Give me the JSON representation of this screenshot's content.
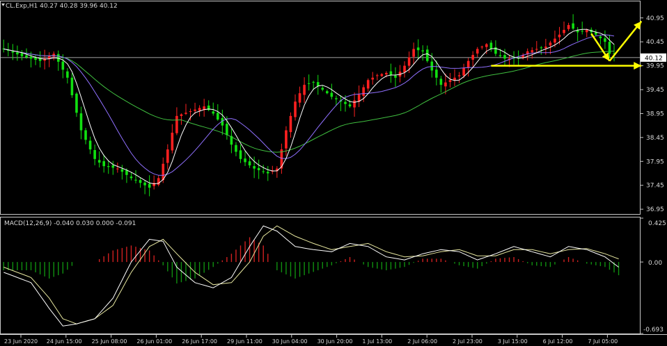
{
  "window": {
    "symbol_line": "CL.Exp,H1 40.27 40.28 39.96 40.12"
  },
  "chart_data": [
    {
      "type": "candlestick",
      "symbol": "CL.Exp",
      "timeframe": "H1",
      "ohlc_header": {
        "open": 40.27,
        "high": 40.28,
        "low": 39.96,
        "close": 40.12
      },
      "current_price": 40.12,
      "ylim": [
        36.85,
        41.15
      ],
      "y_ticks": [
        {
          "value": 40.95,
          "label": "40.95"
        },
        {
          "value": 40.45,
          "label": "40.45"
        },
        {
          "value": 39.95,
          "label": "39.95"
        },
        {
          "value": 39.45,
          "label": "39.45"
        },
        {
          "value": 38.95,
          "label": "38.95"
        },
        {
          "value": 38.45,
          "label": "38.45"
        },
        {
          "value": 37.95,
          "label": "37.95"
        },
        {
          "value": 37.45,
          "label": "37.45"
        },
        {
          "value": 36.95,
          "label": "36.95"
        }
      ],
      "x_ticks": [
        "23 Jun 2020",
        "24 Jun 15:00",
        "25 Jun 08:00",
        "26 Jun 01:00",
        "26 Jun 17:00",
        "29 Jun 11:00",
        "30 Jun 04:00",
        "30 Jun 20:00",
        "1 Jul 13:00",
        "2 Jul 06:00",
        "2 Jul 23:00",
        "3 Jul 15:00",
        "6 Jul 12:00",
        "7 Jul 05:00"
      ],
      "colors": {
        "up": "#ff2020",
        "down": "#10e010",
        "ma_fast": "#ffffff",
        "ma_mid": "#9070ff",
        "ma_slow": "#40c040",
        "annotation": "#ffff00"
      },
      "close_path": [
        [
          0,
          40.3
        ],
        [
          4,
          40.15
        ],
        [
          8,
          40.05
        ],
        [
          11,
          40.2
        ],
        [
          14,
          39.7
        ],
        [
          17,
          38.6
        ],
        [
          20,
          38.0
        ],
        [
          22,
          37.85
        ],
        [
          25,
          37.8
        ],
        [
          28,
          37.6
        ],
        [
          30,
          37.5
        ],
        [
          32,
          37.4
        ],
        [
          34,
          37.6
        ],
        [
          36,
          38.2
        ],
        [
          38,
          38.9
        ],
        [
          41,
          39.0
        ],
        [
          44,
          39.1
        ],
        [
          46,
          38.95
        ],
        [
          48,
          38.7
        ],
        [
          50,
          38.3
        ],
        [
          52,
          38.0
        ],
        [
          55,
          37.8
        ],
        [
          58,
          37.7
        ],
        [
          60,
          37.8
        ],
        [
          62,
          38.6
        ],
        [
          64,
          39.2
        ],
        [
          66,
          39.55
        ],
        [
          68,
          39.6
        ],
        [
          70,
          39.45
        ],
        [
          72,
          39.3
        ],
        [
          74,
          39.2
        ],
        [
          76,
          39.1
        ],
        [
          78,
          39.35
        ],
        [
          80,
          39.65
        ],
        [
          82,
          39.75
        ],
        [
          84,
          39.8
        ],
        [
          86,
          39.7
        ],
        [
          88,
          39.95
        ],
        [
          90,
          40.3
        ],
        [
          92,
          40.25
        ],
        [
          94,
          39.85
        ],
        [
          96,
          39.55
        ],
        [
          98,
          39.65
        ],
        [
          100,
          39.75
        ],
        [
          102,
          40.05
        ],
        [
          104,
          40.3
        ],
        [
          106,
          40.4
        ],
        [
          108,
          40.2
        ],
        [
          110,
          40.1
        ],
        [
          113,
          40.1
        ],
        [
          115,
          40.25
        ],
        [
          117,
          40.3
        ],
        [
          119,
          40.35
        ],
        [
          122,
          40.6
        ],
        [
          124,
          40.8
        ],
        [
          126,
          40.65
        ],
        [
          128,
          40.7
        ],
        [
          130,
          40.6
        ],
        [
          132,
          40.45
        ],
        [
          133,
          40.2
        ]
      ],
      "annotations": [
        {
          "type": "arrow",
          "from": [
            129,
            40.62
          ],
          "to": [
            133,
            40.05
          ],
          "label": ""
        },
        {
          "type": "arrow",
          "from": [
            133,
            40.05
          ],
          "to": [
            140,
            40.88
          ],
          "label": ""
        },
        {
          "type": "horizontal_arrow",
          "y": 39.95,
          "from_x": 107,
          "to_x": 140,
          "label": ""
        }
      ]
    },
    {
      "type": "macd",
      "title": "MACD(12,26,9) -0.040 0.030 0.000 -0.091",
      "params": [
        12,
        26,
        9
      ],
      "values_header": [
        -0.04,
        0.03,
        0.0,
        -0.091
      ],
      "ylim": [
        -0.693,
        0.425
      ],
      "y_ticks": [
        {
          "value": 0.425,
          "label": "0.425"
        },
        {
          "value": 0.0,
          "label": "0.00"
        },
        {
          "value": -0.693,
          "label": "-0.693"
        }
      ],
      "macd_line": [
        [
          0,
          -0.1
        ],
        [
          6,
          -0.2
        ],
        [
          10,
          -0.45
        ],
        [
          13,
          -0.62
        ],
        [
          16,
          -0.6
        ],
        [
          20,
          -0.55
        ],
        [
          24,
          -0.35
        ],
        [
          28,
          0.0
        ],
        [
          32,
          0.22
        ],
        [
          35,
          0.2
        ],
        [
          38,
          -0.05
        ],
        [
          42,
          -0.2
        ],
        [
          46,
          -0.25
        ],
        [
          50,
          -0.15
        ],
        [
          54,
          0.15
        ],
        [
          57,
          0.35
        ],
        [
          60,
          0.3
        ],
        [
          64,
          0.15
        ],
        [
          68,
          0.12
        ],
        [
          72,
          0.1
        ],
        [
          76,
          0.18
        ],
        [
          80,
          0.15
        ],
        [
          84,
          0.05
        ],
        [
          88,
          0.02
        ],
        [
          92,
          0.08
        ],
        [
          96,
          0.12
        ],
        [
          100,
          0.1
        ],
        [
          104,
          0.02
        ],
        [
          108,
          0.08
        ],
        [
          112,
          0.15
        ],
        [
          116,
          0.1
        ],
        [
          120,
          0.05
        ],
        [
          124,
          0.15
        ],
        [
          128,
          0.12
        ],
        [
          132,
          0.05
        ],
        [
          135,
          -0.05
        ]
      ],
      "signal_line": [
        [
          0,
          -0.05
        ],
        [
          6,
          -0.15
        ],
        [
          10,
          -0.35
        ],
        [
          13,
          -0.55
        ],
        [
          16,
          -0.6
        ],
        [
          20,
          -0.55
        ],
        [
          24,
          -0.42
        ],
        [
          28,
          -0.1
        ],
        [
          32,
          0.15
        ],
        [
          35,
          0.22
        ],
        [
          38,
          0.08
        ],
        [
          42,
          -0.1
        ],
        [
          46,
          -0.22
        ],
        [
          50,
          -0.2
        ],
        [
          54,
          0.0
        ],
        [
          57,
          0.25
        ],
        [
          60,
          0.35
        ],
        [
          64,
          0.25
        ],
        [
          68,
          0.18
        ],
        [
          72,
          0.12
        ],
        [
          76,
          0.15
        ],
        [
          80,
          0.18
        ],
        [
          84,
          0.1
        ],
        [
          88,
          0.05
        ],
        [
          92,
          0.06
        ],
        [
          96,
          0.1
        ],
        [
          100,
          0.12
        ],
        [
          104,
          0.06
        ],
        [
          108,
          0.06
        ],
        [
          112,
          0.12
        ],
        [
          116,
          0.12
        ],
        [
          120,
          0.08
        ],
        [
          124,
          0.12
        ],
        [
          128,
          0.13
        ],
        [
          132,
          0.08
        ],
        [
          135,
          0.03
        ]
      ],
      "colors": {
        "macd": "#ffffff",
        "signal": "#e8e8a0",
        "hist_pos": "#d02020",
        "hist_neg": "#109010"
      }
    }
  ]
}
